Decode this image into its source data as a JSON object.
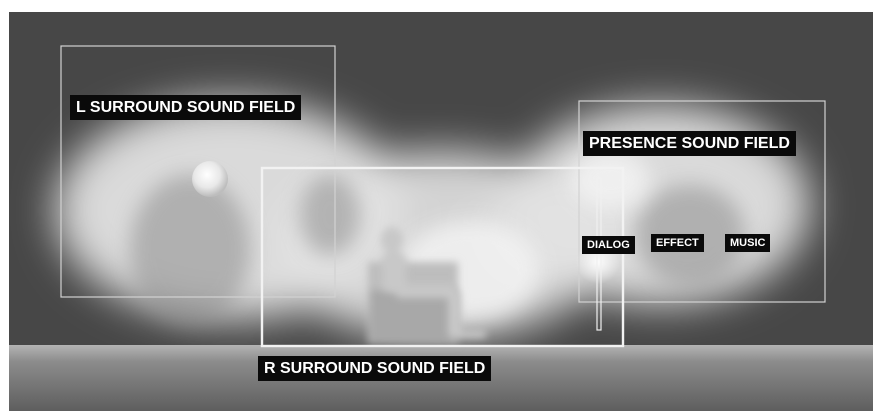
{
  "labels": {
    "l_surround": "L SURROUND SOUND FIELD",
    "presence": "PRESENCE SOUND FIELD",
    "r_surround": "R SURROUND SOUND FIELD",
    "dialog": "DIALOG",
    "effect": "EFFECT",
    "music": "MUSIC"
  },
  "colors": {
    "background": "#474747",
    "floor": "#9a9a9a",
    "field_glow": "#e6e6e6",
    "label_bg": "#0a0a0a",
    "label_text": "#ffffff",
    "frame": "#dcdcdc"
  }
}
